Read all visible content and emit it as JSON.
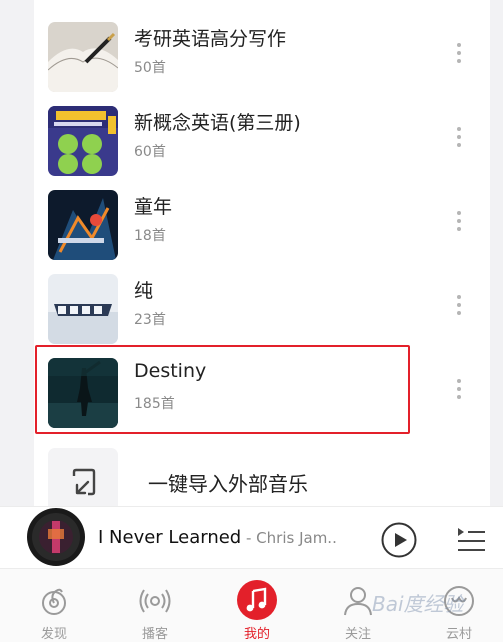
{
  "playlists": [
    {
      "title": "考研英语高分写作",
      "count": "50首"
    },
    {
      "title": "新概念英语(第三册)",
      "count": "60首"
    },
    {
      "title": "童年",
      "count": "18首"
    },
    {
      "title": "纯",
      "count": "23首"
    },
    {
      "title": "Destiny",
      "count": "185首"
    }
  ],
  "import": {
    "label": "一键导入外部音乐"
  },
  "player": {
    "song": "I Never Learned",
    "artist": " - Chris Jam..."
  },
  "tabs": [
    {
      "label": "发现",
      "icon": "discover-icon"
    },
    {
      "label": "播客",
      "icon": "podcast-icon"
    },
    {
      "label": "我的",
      "icon": "music-note-icon",
      "active": true
    },
    {
      "label": "关注",
      "icon": "follow-icon"
    },
    {
      "label": "云村",
      "icon": "cloud-village-icon"
    }
  ],
  "colors": {
    "accent": "#e3202a",
    "highlight_border": "#e3202a"
  },
  "watermark": "Bai度经验"
}
